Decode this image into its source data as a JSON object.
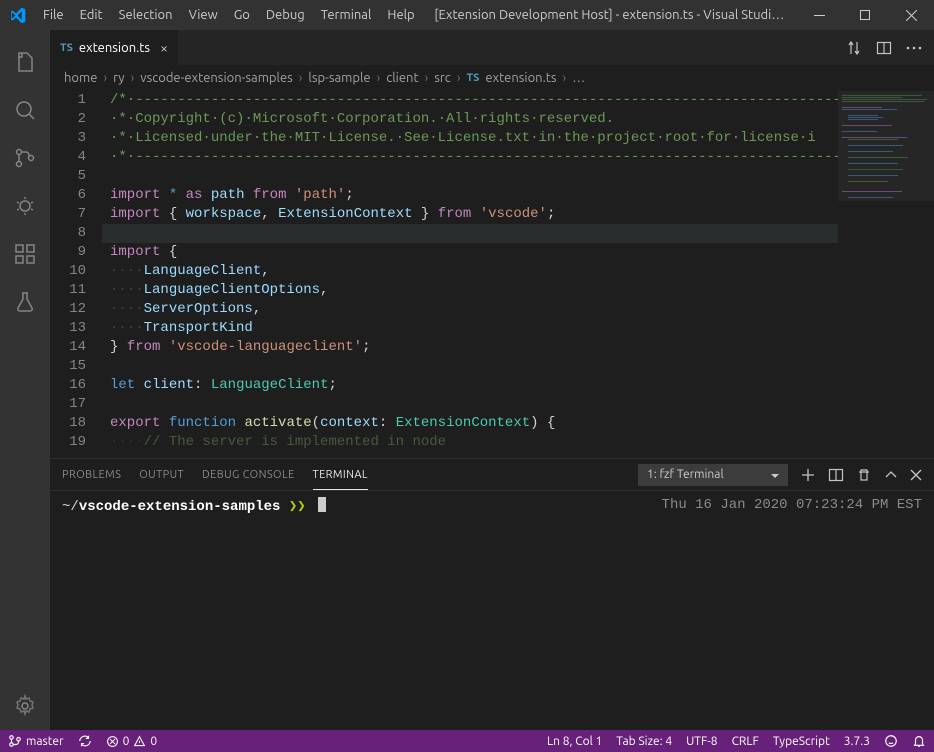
{
  "menubar": {
    "items": [
      "File",
      "Edit",
      "Selection",
      "View",
      "Go",
      "Debug",
      "Terminal",
      "Help"
    ],
    "title": "[Extension Development Host] - extension.ts - Visual Studi…"
  },
  "activitybar": {
    "icons": [
      "files",
      "search",
      "source-control",
      "debug",
      "extensions",
      "testing"
    ]
  },
  "tabs": {
    "open": [
      {
        "icon": "ts",
        "label": "extension.ts"
      }
    ]
  },
  "breadcrumbs": {
    "segments": [
      "home",
      "ry",
      "vscode-extension-samples",
      "lsp-sample",
      "client",
      "src",
      "extension.ts",
      "…"
    ],
    "file_icon_at": 6
  },
  "editor": {
    "lines": [
      {
        "n": 1,
        "html": "/*·------------------------------------------------------------------------------------------",
        "cls": "c-comment"
      },
      {
        "n": 2,
        "html": "·*·Copyright·(c)·Microsoft·Corporation.·All·rights·reserved.",
        "cls": "c-comment"
      },
      {
        "n": 3,
        "html": "·*·Licensed·under·the·MIT·License.·See·License.txt·in·the·project·root·for·license·i",
        "cls": "c-comment"
      },
      {
        "n": 4,
        "html": "·*·----------------------------------------------------------------------------------------",
        "cls": "c-comment"
      },
      {
        "n": 5,
        "html": ""
      },
      {
        "n": 6,
        "html": "<span class=\"c-kw\">import</span> <span class=\"c-kw2\">*</span> <span class=\"c-kw\">as</span> <span class=\"c-var\">path</span> <span class=\"c-kw\">from</span> <span class=\"c-str\">'path'</span>;"
      },
      {
        "n": 7,
        "html": "<span class=\"c-kw\">import</span> { <span class=\"c-var\">workspace</span>, <span class=\"c-var\">ExtensionContext</span> } <span class=\"c-kw\">from</span> <span class=\"c-str\">'vscode'</span>;"
      },
      {
        "n": 8,
        "html": "",
        "hl": true
      },
      {
        "n": 9,
        "html": "<span class=\"c-kw\">import</span> {"
      },
      {
        "n": 10,
        "html": "<span class=\"c-ws\">····</span><span class=\"c-var\">LanguageClient</span>,"
      },
      {
        "n": 11,
        "html": "<span class=\"c-ws\">····</span><span class=\"c-var\">LanguageClientOptions</span>,"
      },
      {
        "n": 12,
        "html": "<span class=\"c-ws\">····</span><span class=\"c-var\">ServerOptions</span>,"
      },
      {
        "n": 13,
        "html": "<span class=\"c-ws\">····</span><span class=\"c-var\">TransportKind</span>"
      },
      {
        "n": 14,
        "html": "} <span class=\"c-kw\">from</span> <span class=\"c-str\">'vscode-languageclient'</span>;"
      },
      {
        "n": 15,
        "html": ""
      },
      {
        "n": 16,
        "html": "<span class=\"c-kw2\">let</span> <span class=\"c-var\">client</span>: <span class=\"c-type\">LanguageClient</span>;"
      },
      {
        "n": 17,
        "html": ""
      },
      {
        "n": 18,
        "html": "<span class=\"c-kw\">export</span> <span class=\"c-kw2\">function</span> <span class=\"c-fn\">activate</span>(<span class=\"c-var\">context</span>: <span class=\"c-type\">ExtensionContext</span>) {"
      },
      {
        "n": 19,
        "html": "<span class=\"c-ws\">····</span><span class=\"c-comment\">// The server is implemented in node</span>",
        "fade": true
      }
    ]
  },
  "panel": {
    "tabs": {
      "problems": "PROBLEMS",
      "output": "OUTPUT",
      "debug": "DEBUG CONSOLE",
      "terminal": "TERMINAL"
    },
    "terminal_selector": "1: fzf Terminal",
    "prompt": {
      "cwd_prefix": "~/",
      "cwd": "vscode-extension-samples"
    },
    "timestamp": "Thu 16 Jan 2020 07:23:24 PM EST"
  },
  "statusbar": {
    "branch": "master",
    "errors": "0",
    "warnings": "0",
    "cursor": "Ln 8, Col 1",
    "tabsize": "Tab Size: 4",
    "encoding": "UTF-8",
    "eol": "CRLF",
    "language": "TypeScript",
    "ts_version": "3.7.3"
  }
}
